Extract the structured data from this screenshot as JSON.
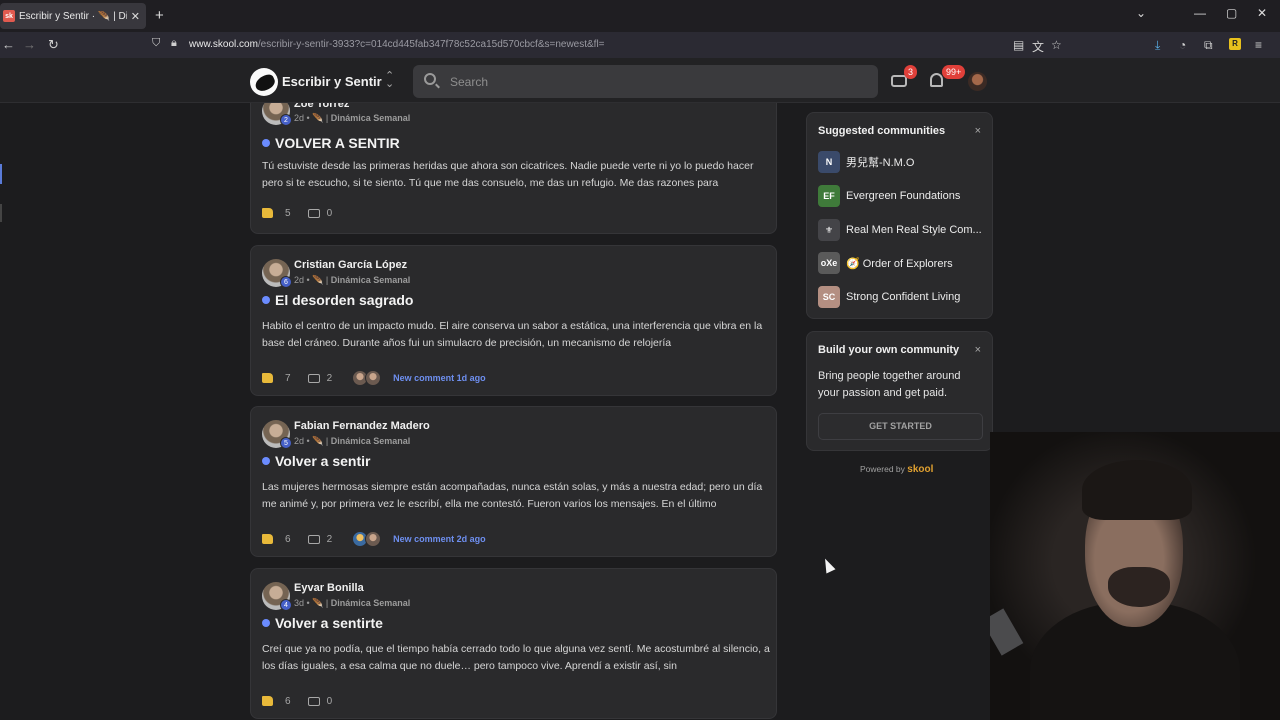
{
  "browser": {
    "tab_title": "Escribir y Sentir · 🪶 | Dinámica",
    "tab_favicon": "sk",
    "url_host": "www.skool.com",
    "url_path": "/escribir-y-sentir-3933?c=014cd445fab347f78c52ca15d570cbcf&s=newest&fl="
  },
  "header": {
    "community_name": "Escribir y Sentir",
    "search_placeholder": "Search",
    "chat_badge": "3",
    "notif_badge": "99+"
  },
  "posts": [
    {
      "author": "Zoe Torrez",
      "level": "2",
      "meta_time": "2d • 🪶 |",
      "category": "Dinámica Semanal",
      "title": "VOLVER A SENTIR",
      "body": "Tú estuviste desde las primeras heridas que ahora son cicatrices. Nadie puede verte ni yo lo puedo hacer pero si te escucho, si te siento. Tú que me das consuelo, me das un refugio. Me das razones para",
      "likes": "5",
      "comments": "0",
      "new_comment": ""
    },
    {
      "author": "Cristian García López",
      "level": "6",
      "meta_time": "2d • 🪶 |",
      "category": "Dinámica Semanal",
      "title": "El desorden sagrado",
      "body": "Habito el centro de un impacto mudo. El aire conserva un sabor a estática, una interferencia que vibra en la base del cráneo. Durante años fui un simulacro de precisión, un mecanismo de relojería",
      "likes": "7",
      "comments": "2",
      "new_comment": "New comment 1d ago"
    },
    {
      "author": "Fabian Fernandez Madero",
      "level": "5",
      "meta_time": "2d • 🪶 |",
      "category": "Dinámica Semanal",
      "title": "Volver a sentir",
      "body": "Las mujeres hermosas siempre están acompañadas, nunca están solas, y más a nuestra edad; pero un día me animé y, por primera vez le escribí, ella me contestó. Fueron varios los mensajes. En el último",
      "likes": "6",
      "comments": "2",
      "new_comment": "New comment 2d ago"
    },
    {
      "author": "Eyvar Bonilla",
      "level": "4",
      "meta_time": "3d • 🪶 |",
      "category": "Dinámica Semanal",
      "title": "Volver a sentirte",
      "body": "Creí que ya no podía, que el tiempo había cerrado todo lo que alguna vez sentí. Me acostumbré al silencio, a los días iguales, a esa calma que no duele… pero tampoco vive. Aprendí a existir así, sin",
      "likes": "6",
      "comments": "0",
      "new_comment": ""
    }
  ],
  "suggested": {
    "title": "Suggested communities",
    "close": "×",
    "items": [
      {
        "name": "男兒幫-N.M.O",
        "color": "#3a4a6a",
        "initials": "N"
      },
      {
        "name": "Evergreen Foundations",
        "color": "#3f7a3a",
        "initials": "EF"
      },
      {
        "name": "Real Men Real Style Com...",
        "color": "#444448",
        "initials": "⚜"
      },
      {
        "name": "🧭 Order of Explorers",
        "color": "#5a5a5a",
        "initials": "oXe"
      },
      {
        "name": "Strong Confident Living",
        "color": "#b48f82",
        "initials": "SC"
      }
    ]
  },
  "build": {
    "title": "Build your own community",
    "close": "×",
    "text": "Bring people together around your passion and get paid.",
    "button": "GET STARTED"
  },
  "powered": {
    "label": "Powered by",
    "brand": "skool"
  }
}
